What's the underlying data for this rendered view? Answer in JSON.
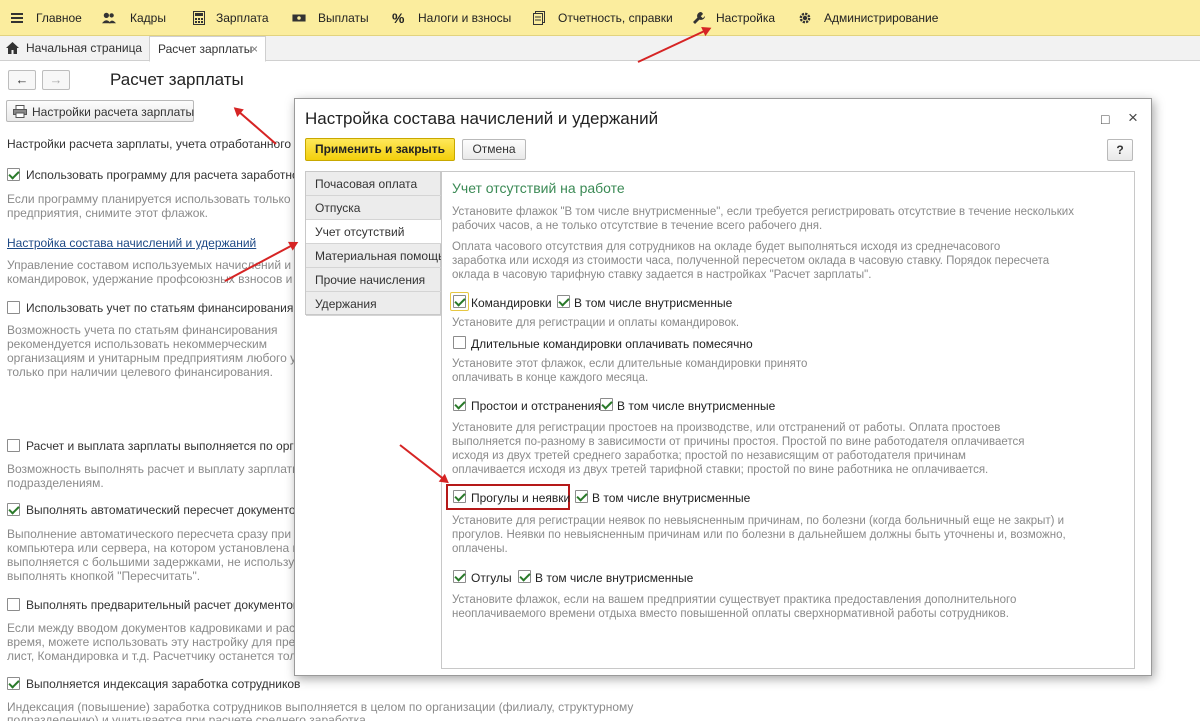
{
  "menu": {
    "items": [
      {
        "label": "Главное",
        "icon": "hamburger-icon"
      },
      {
        "label": "Кадры",
        "icon": "people-icon"
      },
      {
        "label": "Зарплата",
        "icon": "calculator-icon"
      },
      {
        "label": "Выплаты",
        "icon": "money-icon"
      },
      {
        "label": "Налоги и взносы",
        "icon": "percent-icon"
      },
      {
        "label": "Отчетность, справки",
        "icon": "report-icon"
      },
      {
        "label": "Настройка",
        "icon": "wrench-icon"
      },
      {
        "label": "Администрирование",
        "icon": "gear-icon"
      }
    ]
  },
  "tabs": {
    "home": "Начальная страница",
    "current": "Расчет зарплаты",
    "close": "×"
  },
  "page": {
    "title": "Расчет зарплаты",
    "back": "←",
    "forward": "→",
    "settings_button": "Настройки расчета зарплаты",
    "intro": "Настройки расчета зарплаты, учета отработанного време",
    "use_program": "Использовать программу для расчета заработной п",
    "use_program_hint_1": "Если программу планируется использовать только для",
    "use_program_hint_2": "предприятия, снимите этот флажок.",
    "composition_link": "Настройка состава начислений и удержаний",
    "composition_hint_1": "Управление составом используемых начислений и удер",
    "composition_hint_2": "командировок, удержание профсоюзных взносов и т.д.",
    "financing": "Использовать учет по статьям финансирования",
    "financing_hint_1": "Возможность учета по статьям финансирования",
    "financing_hint_2": "рекомендуется использовать некоммерческим",
    "financing_hint_3": "организациям и унитарным предприятиям любого уров",
    "financing_hint_4": "только при наличии целевого финансирования.",
    "by_divisions": "Расчет и выплата зарплаты выполняется по органи",
    "by_divisions_hint_1": "Возможность выполнять расчет и выплату зарплаты по",
    "by_divisions_hint_2": "подразделениям.",
    "auto_recalc": "Выполнять автоматический пересчет документов пр",
    "auto_recalc_hint_1": "Выполнение автоматического пересчета сразу при ред",
    "auto_recalc_hint_2": "компьютера или сервера, на котором установлена прог",
    "auto_recalc_hint_3": "выполняется с большими задержками, не используйте",
    "auto_recalc_hint_4": "выполнять кнопкой \"Пересчитать\".",
    "prelim": "Выполнять предварительный расчет документов",
    "prelim_hint_1": "Если между вводом документов кадровиками и расчет",
    "prelim_hint_2": "время, можете использовать эту настройку для предва",
    "prelim_hint_3": "лист, Командировка и т.д. Расчетчику останется тольк",
    "indexation": "Выполняется индексация заработка сотрудников",
    "indexation_hint_1": "Индексация (повышение) заработка сотрудников выполняется в целом по организации (филиалу, структурному",
    "indexation_hint_2": "подразделению) и учитывается при расчете среднего заработка."
  },
  "dialog": {
    "title": "Настройка состава начислений и удержаний",
    "apply_close": "Применить и закрыть",
    "cancel": "Отмена",
    "help": "?",
    "maximize": "□",
    "close": "×",
    "left_tabs": [
      "Почасовая оплата",
      "Отпуска",
      "Учет отсутствий",
      "Материальная помощь",
      "Прочие начисления",
      "Удержания"
    ],
    "panel_title": "Учет отсутствий на работе",
    "intro_1": "Установите флажок \"В том числе внутрисменные\", если требуется регистрировать отсутствие в течение нескольких",
    "intro_2": "рабочих часов, а не только отсутствие в течение всего рабочего дня.",
    "pay_1": "Оплата часового отсутствия для сотрудников на окладе будет выполняться исходя из среднечасового",
    "pay_2": "заработка или исходя из стоимости часа, полученной пересчетом оклада в часовую ставку. Порядок пересчета",
    "pay_3": "оклада в часовую тарифную ставку задается в настройках \"Расчет зарплаты\".",
    "trips": "Командировки",
    "intra": "В том числе внутрисменные",
    "trips_hint": "Установите для регистрации и оплаты командировок.",
    "long_trips": "Длительные командировки оплачивать помесячно",
    "long_trips_hint_1": "Установите этот флажок, если длительные командировки принято",
    "long_trips_hint_2": "оплачивать в конце каждого месяца.",
    "idle": "Простои и отстранения",
    "idle_hint_1": "Установите для регистрации простоев на производстве, или отстранений от работы. Оплата простоев",
    "idle_hint_2": "выполняется по-разному в зависимости от причины простоя. Простой по вине работодателя оплачивается",
    "idle_hint_3": "исходя из двух третей среднего заработка; простой по независящим от работодателя причинам",
    "idle_hint_4": "оплачивается исходя из двух третей тарифной ставки; простой по вине работника не оплачивается.",
    "absence": "Прогулы и неявки",
    "absence_hint_1": "Установите для регистрации неявок по невыясненным причинам, по болезни (когда больничный еще не закрыт) и",
    "absence_hint_2": "прогулов. Неявки по невыясненным причинам или по болезни в дальнейшем должны быть уточнены и, возможно,",
    "absence_hint_3": "оплачены.",
    "timeoff": "Отгулы",
    "timeoff_hint_1": "Установите флажок, если на вашем предприятии существует практика предоставления дополнительного",
    "timeoff_hint_2": "неоплачиваемого времени отдыха вместо повышенной оплаты сверхнормативной работы сотрудников."
  },
  "colors": {
    "topbar": "#fbed9e",
    "primary_button": "#f3cf0b",
    "panel_title": "#3b8a55",
    "highlight": "#b51919",
    "arrow": "#d62424"
  }
}
